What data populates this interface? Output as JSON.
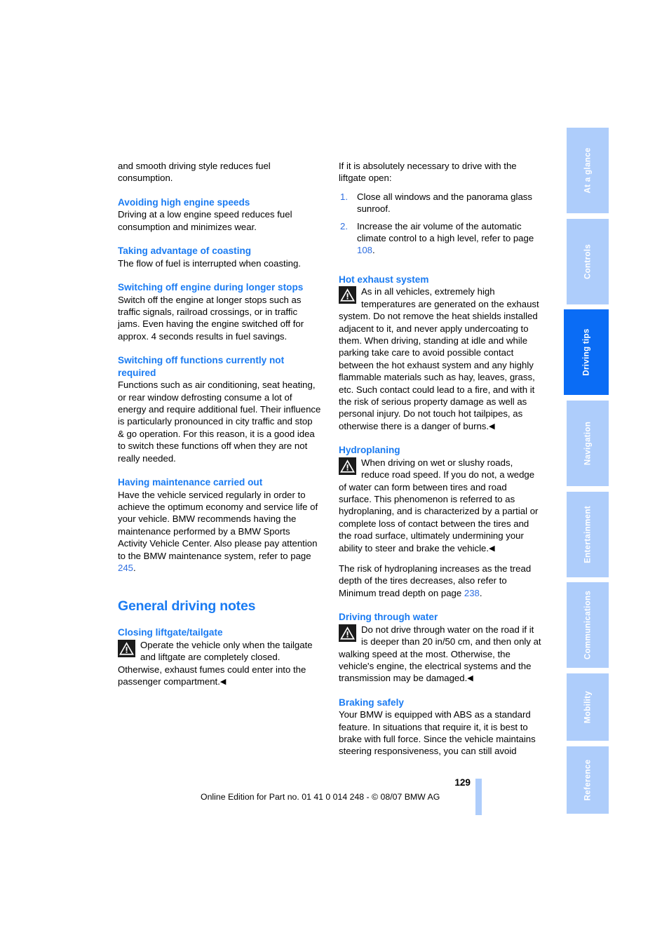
{
  "document": {
    "page_number": "129",
    "edition_notice": "Online Edition for Part no. 01 41 0 014 248 - © 08/07 BMW AG"
  },
  "register_tabs": [
    {
      "label": "At a glance",
      "active": false
    },
    {
      "label": "Controls",
      "active": false
    },
    {
      "label": "Driving tips",
      "active": true
    },
    {
      "label": "Navigation",
      "active": false
    },
    {
      "label": "Entertainment",
      "active": false
    },
    {
      "label": "Communications",
      "active": false
    },
    {
      "label": "Mobility",
      "active": false
    },
    {
      "label": "Reference",
      "active": false
    }
  ],
  "left_column": {
    "intro_paragraph": "and smooth driving style reduces fuel consumption.",
    "section_avoiding_speeds": {
      "heading": "Avoiding high engine speeds",
      "body": "Driving at a low engine speed reduces fuel consumption and minimizes wear."
    },
    "section_coasting": {
      "heading": "Taking advantage of coasting",
      "body": "The flow of fuel is interrupted when coasting."
    },
    "section_switching_off_engine": {
      "heading": "Switching off engine during longer stops",
      "body": "Switch off the engine at longer stops such as traffic signals, railroad crossings, or in traffic jams. Even having the engine switched off for approx. 4 seconds results in fuel savings."
    },
    "section_switching_off_functions": {
      "heading": "Switching off functions currently not required",
      "body": "Functions such as air conditioning, seat heating, or rear window defrosting consume a lot of energy and require additional fuel. Their influence is particularly pronounced in city traffic and stop & go operation. For this reason, it is a good idea to switch these functions off when they are not really needed."
    },
    "section_maintenance": {
      "heading": "Having maintenance carried out",
      "body_before_ref": "Have the vehicle serviced regularly in order to achieve the optimum economy and service life of your vehicle. BMW recommends having the maintenance performed by a BMW Sports Activity Vehicle Center. Also please pay attention to the BMW maintenance system, refer to page ",
      "page_ref": "245",
      "body_after_ref": "."
    },
    "chapter_heading": "General driving notes",
    "section_closing_liftgate": {
      "heading": "Closing liftgate/tailgate",
      "warning_icon": "warning-triangle-icon",
      "warning_text": "Operate the vehicle only when the tailgate and liftgate are completely closed. Otherwise, exhaust fumes could enter into the passenger compartment.",
      "end_mark": "◀"
    }
  },
  "right_column": {
    "intro_paragraph": "If it is absolutely necessary to drive with the liftgate open:",
    "steps": [
      {
        "number": "1.",
        "text_before_ref": "Close all windows and the panorama glass sunroof.",
        "page_ref": "",
        "text_after_ref": ""
      },
      {
        "number": "2.",
        "text_before_ref": "Increase the air volume of the automatic climate control to a high level, refer to page ",
        "page_ref": "108",
        "text_after_ref": "."
      }
    ],
    "section_hot_exhaust": {
      "heading": "Hot exhaust system",
      "warning_icon": "warning-triangle-icon",
      "warning_text": "As in all vehicles, extremely high temperatures are generated on the exhaust system. Do not remove the heat shields installed adjacent to it, and never apply undercoating to them. When driving, standing at idle and while parking take care to avoid possible contact between the hot exhaust system and any highly flammable materials such as hay, leaves, grass, etc. Such contact could lead to a fire, and with it the risk of serious property damage as well as personal injury. Do not touch hot tailpipes, as otherwise there is a danger of burns.",
      "end_mark": "◀"
    },
    "section_hydroplaning": {
      "heading": "Hydroplaning",
      "warning_icon": "warning-triangle-icon",
      "warning_text": "When driving on wet or slushy roads, reduce road speed. If you do not, a wedge of water can form between tires and road surface. This phenomenon is referred to as hydroplaning, and is characterized by a partial or complete loss of contact between the tires and the road surface, ultimately undermining your ability to steer and brake the vehicle.",
      "end_mark": "◀",
      "followup_before_ref": "The risk of hydroplaning increases as the tread depth of the tires decreases, also refer to Minimum tread depth on page ",
      "followup_page_ref": "238",
      "followup_after_ref": "."
    },
    "section_driving_through_water": {
      "heading": "Driving through water",
      "warning_icon": "warning-triangle-icon",
      "warning_text": "Do not drive through water on the road if it is deeper than 20 in/50 cm, and then only at walking speed at the most. Otherwise, the vehicle's engine, the electrical systems and the transmission may be damaged.",
      "end_mark": "◀"
    },
    "section_braking_safely": {
      "heading": "Braking safely",
      "body": "Your BMW is equipped with ABS as a standard feature. In situations that require it, it is best to brake with full force. Since the vehicle maintains steering responsiveness, you can still avoid"
    }
  },
  "colors": {
    "heading_blue": "#1a7bf2",
    "page_ref_blue": "#2f6fe0",
    "tab_inactive": "#aecdfb",
    "tab_active": "#0a6cf5",
    "text_black": "#000000"
  }
}
